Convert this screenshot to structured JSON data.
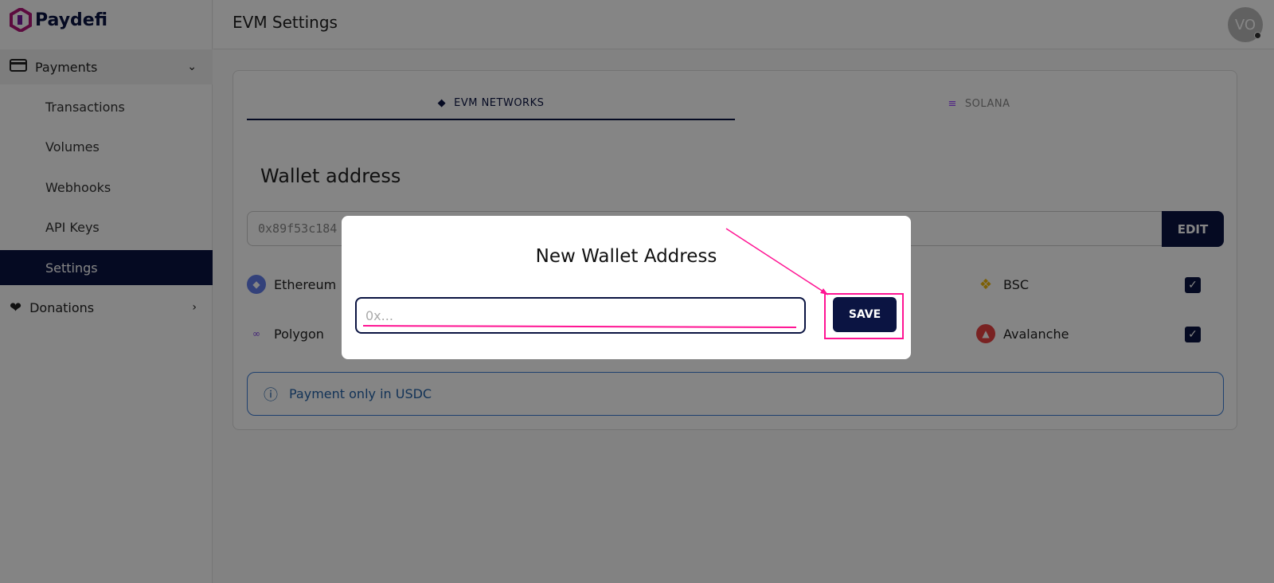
{
  "brand": {
    "name": "Paydefi"
  },
  "sidebar": {
    "payments": {
      "label": "Payments",
      "icon": "credit-card-icon"
    },
    "items": [
      {
        "label": "Transactions"
      },
      {
        "label": "Volumes"
      },
      {
        "label": "Webhooks"
      },
      {
        "label": "API Keys"
      },
      {
        "label": "Settings",
        "active": true
      }
    ],
    "donations": {
      "label": "Donations",
      "icon": "hand-heart-icon"
    }
  },
  "header": {
    "title": "EVM Settings",
    "avatar": "VO"
  },
  "tabs": [
    {
      "label": "EVM NETWORKS",
      "icon": "ethereum-icon",
      "active": true
    },
    {
      "label": "SOLANA",
      "icon": "solana-icon"
    }
  ],
  "wallet": {
    "title": "Wallet address",
    "value": "0x89f53c184",
    "edit_label": "EDIT"
  },
  "networks": [
    {
      "label": "Ethereum",
      "color": "#627eea"
    },
    {
      "label": "Polygon",
      "color": "#8247e5"
    },
    {
      "label": "BSC",
      "color": "#f0b90b",
      "checked": true
    },
    {
      "label": "Avalanche",
      "color": "#e84142",
      "checked": true
    }
  ],
  "info": {
    "text": "Payment only in USDC"
  },
  "modal": {
    "title": "New Wallet Address",
    "placeholder": "0x...",
    "save_label": "SAVE"
  },
  "colors": {
    "primary": "#0b1442",
    "annotation": "#ff1493"
  }
}
